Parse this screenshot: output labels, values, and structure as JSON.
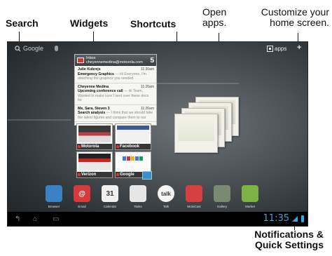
{
  "callouts": {
    "search": "Search",
    "widgets": "Widgets",
    "shortcuts": "Shortcuts",
    "open_apps": [
      "Open",
      "apps."
    ],
    "customize": [
      "Customize your",
      "home screen."
    ],
    "notifications": [
      "Notifications &",
      "Quick Settings"
    ]
  },
  "screen": {
    "search_text": "Google",
    "apps_label": "apps",
    "plus_label": "+",
    "email_widget": {
      "account_line1": "Inbox",
      "account_line2": "cheyennemedina@motorola.com",
      "unread_count": "5",
      "messages": [
        {
          "from": "Julie Kubrejs",
          "time": "11:30am",
          "subject": "Emergency Graphics",
          "preview": "— Hi Everyone, I'm attaching the graphics you needed"
        },
        {
          "from": "Cheyenne Medina",
          "time": "11:26am",
          "subject": "Upcoming conference call",
          "preview": "— Hi Team, Wanted to make sure I sent over these docs for"
        },
        {
          "from": "Me, Sara, Steven  3",
          "time": "11:26am",
          "subject": "Search analysis",
          "preview": "— I think that we should take the latest figures and compare them to our"
        }
      ]
    },
    "shortcut_windows": [
      {
        "label": "Motorola"
      },
      {
        "label": "Facebook"
      },
      {
        "label": "Verizon"
      },
      {
        "label": "Google"
      }
    ],
    "dock": [
      {
        "label": "Browser",
        "icon": "browser-icon",
        "color": "#3b82c4",
        "glyph": ""
      },
      {
        "label": "Email",
        "icon": "email-icon",
        "color": "#d83a3a",
        "glyph": "@"
      },
      {
        "label": "Calendar",
        "icon": "calendar-icon",
        "color": "#f0f0f0",
        "glyph": "31"
      },
      {
        "label": "Tasks",
        "icon": "tasks-icon",
        "color": "#e6e6e6",
        "glyph": ""
      },
      {
        "label": "Talk",
        "icon": "talk-icon",
        "color": "#f5f5f5",
        "glyph": "talk"
      },
      {
        "label": "MotoCast",
        "icon": "motocast-icon",
        "color": "#d84040",
        "glyph": ""
      },
      {
        "label": "Gallery",
        "icon": "gallery-icon",
        "color": "#7a8a70",
        "glyph": ""
      },
      {
        "label": "Market",
        "icon": "market-icon",
        "color": "#7cb342",
        "glyph": ""
      }
    ],
    "clock": "11:35"
  }
}
